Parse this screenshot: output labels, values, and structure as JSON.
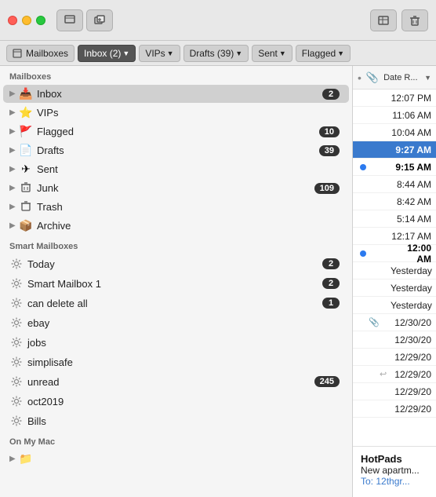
{
  "titlebar": {
    "compose_label": "✏",
    "new_window_label": "⊞",
    "move_label": "⬛",
    "delete_label": "🗑"
  },
  "filterbar": {
    "mailboxes_label": "Mailboxes",
    "inbox_label": "Inbox (2)",
    "vips_label": "VIPs",
    "drafts_label": "Drafts (39)",
    "sent_label": "Sent",
    "flagged_label": "Flagged"
  },
  "sidebar": {
    "mailboxes_header": "Mailboxes",
    "items": [
      {
        "id": "inbox",
        "icon": "📥",
        "label": "Inbox",
        "badge": "2",
        "active": true
      },
      {
        "id": "vips",
        "icon": "⭐",
        "label": "VIPs",
        "badge": ""
      },
      {
        "id": "flagged",
        "icon": "🚩",
        "label": "Flagged",
        "badge": "10"
      },
      {
        "id": "drafts",
        "icon": "📄",
        "label": "Drafts",
        "badge": "39"
      },
      {
        "id": "sent",
        "icon": "✈",
        "label": "Sent",
        "badge": ""
      },
      {
        "id": "junk",
        "icon": "🗑",
        "label": "Junk",
        "badge": "109"
      },
      {
        "id": "trash",
        "icon": "🗑",
        "label": "Trash",
        "badge": ""
      },
      {
        "id": "archive",
        "icon": "📦",
        "label": "Archive",
        "badge": ""
      }
    ],
    "smart_header": "Smart Mailboxes",
    "smart_items": [
      {
        "id": "today",
        "label": "Today",
        "badge": "2"
      },
      {
        "id": "smart1",
        "label": "Smart Mailbox 1",
        "badge": "2"
      },
      {
        "id": "candelete",
        "label": "can delete all",
        "badge": "1"
      },
      {
        "id": "ebay",
        "label": "ebay",
        "badge": ""
      },
      {
        "id": "jobs",
        "label": "jobs",
        "badge": ""
      },
      {
        "id": "simplisafe",
        "label": "simplisafe",
        "badge": ""
      },
      {
        "id": "unread",
        "label": "unread",
        "badge": "245"
      },
      {
        "id": "oct2019",
        "label": "oct2019",
        "badge": ""
      },
      {
        "id": "bills",
        "label": "Bills",
        "badge": ""
      }
    ],
    "onmymac_header": "On My Mac"
  },
  "right_panel": {
    "header": {
      "dot_label": "•",
      "clip_label": "📎",
      "date_label": "Date R...",
      "caret_label": "▼"
    },
    "emails": [
      {
        "time": "12:07 PM",
        "has_dot": false,
        "has_clip": false,
        "has_reply": false,
        "selected": false,
        "bold": false
      },
      {
        "time": "11:06 AM",
        "has_dot": false,
        "has_clip": false,
        "has_reply": false,
        "selected": false,
        "bold": false
      },
      {
        "time": "10:04 AM",
        "has_dot": false,
        "has_clip": false,
        "has_reply": false,
        "selected": false,
        "bold": false
      },
      {
        "time": "9:27 AM",
        "has_dot": false,
        "has_clip": false,
        "has_reply": false,
        "selected": true,
        "bold": false
      },
      {
        "time": "9:15 AM",
        "has_dot": true,
        "has_clip": false,
        "has_reply": false,
        "selected": false,
        "bold": true
      },
      {
        "time": "8:44 AM",
        "has_dot": false,
        "has_clip": false,
        "has_reply": false,
        "selected": false,
        "bold": false
      },
      {
        "time": "8:42 AM",
        "has_dot": false,
        "has_clip": false,
        "has_reply": false,
        "selected": false,
        "bold": false
      },
      {
        "time": "5:14 AM",
        "has_dot": false,
        "has_clip": false,
        "has_reply": false,
        "selected": false,
        "bold": false
      },
      {
        "time": "12:17 AM",
        "has_dot": false,
        "has_clip": false,
        "has_reply": false,
        "selected": false,
        "bold": false
      },
      {
        "time": "12:00 AM",
        "has_dot": true,
        "has_clip": false,
        "has_reply": false,
        "selected": false,
        "bold": true
      },
      {
        "time": "Yesterday",
        "has_dot": false,
        "has_clip": false,
        "has_reply": false,
        "selected": false,
        "bold": false
      },
      {
        "time": "Yesterday",
        "has_dot": false,
        "has_clip": false,
        "has_reply": false,
        "selected": false,
        "bold": false
      },
      {
        "time": "Yesterday",
        "has_dot": false,
        "has_clip": false,
        "has_reply": false,
        "selected": false,
        "bold": false
      },
      {
        "time": "12/30/20",
        "has_dot": false,
        "has_clip": true,
        "has_reply": false,
        "selected": false,
        "bold": false
      },
      {
        "time": "12/30/20",
        "has_dot": false,
        "has_clip": false,
        "has_reply": false,
        "selected": false,
        "bold": false
      },
      {
        "time": "12/29/20",
        "has_dot": false,
        "has_clip": false,
        "has_reply": false,
        "selected": false,
        "bold": false
      },
      {
        "time": "12/29/20",
        "has_dot": false,
        "has_clip": false,
        "has_reply": true,
        "selected": false,
        "bold": false
      },
      {
        "time": "12/29/20",
        "has_dot": false,
        "has_clip": false,
        "has_reply": false,
        "selected": false,
        "bold": false
      },
      {
        "time": "12/29/20",
        "has_dot": false,
        "has_clip": false,
        "has_reply": false,
        "selected": false,
        "bold": false
      }
    ],
    "preview": {
      "sender": "HotPads",
      "subject": "New apartm...",
      "to_label": "To:",
      "to_address": "12thgr..."
    }
  }
}
